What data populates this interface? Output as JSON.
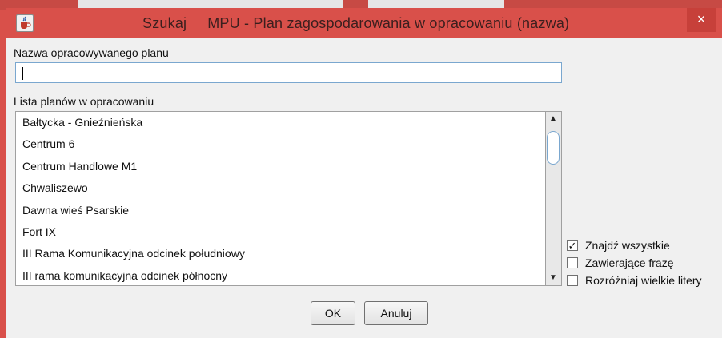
{
  "window": {
    "title": "Szukaj     MPU - Plan zagospodarowania w opracowaniu (nazwa)",
    "close_glyph": "×",
    "icon": "java-cup-icon"
  },
  "name_field": {
    "label": "Nazwa opracowywanego planu",
    "value": ""
  },
  "plan_list": {
    "label": "Lista planów w opracowaniu",
    "items": [
      "Bałtycka - Gnieźnieńska",
      "Centrum 6",
      "Centrum Handlowe M1",
      "Chwaliszewo",
      "Dawna wieś Psarskie",
      "Fort IX",
      "III Rama Komunikacyjna odcinek południowy",
      "III rama komunikacyjna odcinek północny"
    ]
  },
  "options": [
    {
      "label": "Znajdź wszystkie",
      "checked": true
    },
    {
      "label": "Zawierające frazę",
      "checked": false
    },
    {
      "label": "Rozróżniaj wielkie litery",
      "checked": false
    }
  ],
  "buttons": {
    "ok": "OK",
    "cancel": "Anuluj"
  },
  "colors": {
    "titlebar": "#d9504a",
    "focus_border": "#7aa7cf"
  }
}
